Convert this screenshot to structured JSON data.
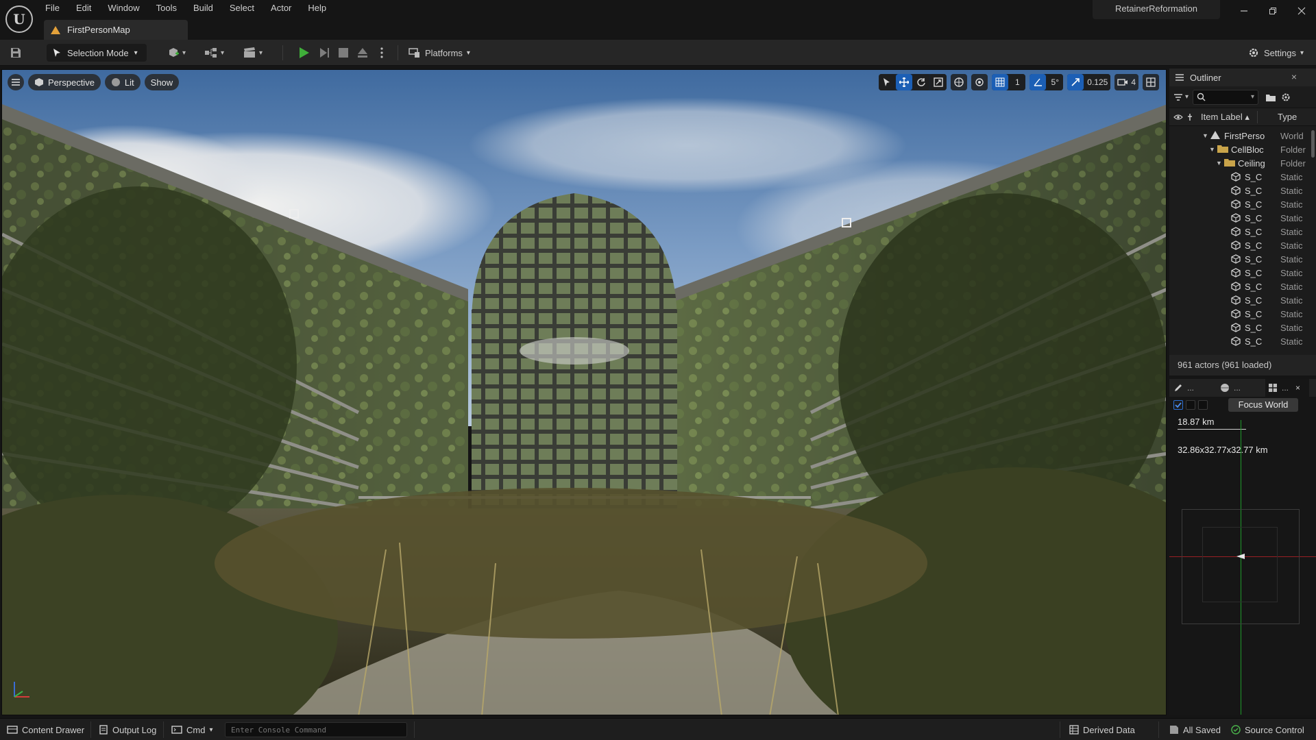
{
  "app": {
    "menu": [
      "File",
      "Edit",
      "Window",
      "Tools",
      "Build",
      "Select",
      "Actor",
      "Help"
    ],
    "project_name": "RetainerReformation",
    "map_tab": "FirstPersonMap",
    "window_buttons": [
      "minimize-icon",
      "restore-icon",
      "close-icon"
    ]
  },
  "toolbar": {
    "selection_mode": "Selection Mode",
    "platforms": "Platforms",
    "settings": "Settings"
  },
  "viewport": {
    "view_mode": "Perspective",
    "lighting": "Lit",
    "show": "Show",
    "grid_snap": "1",
    "angle_snap": "5°",
    "scale_snap": "0.125",
    "camera_speed": "4"
  },
  "outliner": {
    "title": "Outliner",
    "col_label": "Item Label ▴",
    "col_type": "Type",
    "rows": [
      {
        "label": "FirstPerso",
        "type": "World",
        "depth": 0,
        "icon": "world-icon"
      },
      {
        "label": "CellBloc",
        "type": "Folder",
        "depth": 1,
        "icon": "folder-icon"
      },
      {
        "label": "Ceiling",
        "type": "Folder",
        "depth": 2,
        "icon": "folder-icon"
      },
      {
        "label": "S_C",
        "type": "Static",
        "depth": 3,
        "icon": "static-mesh-icon"
      },
      {
        "label": "S_C",
        "type": "Static",
        "depth": 3,
        "icon": "static-mesh-icon"
      },
      {
        "label": "S_C",
        "type": "Static",
        "depth": 3,
        "icon": "static-mesh-icon"
      },
      {
        "label": "S_C",
        "type": "Static",
        "depth": 3,
        "icon": "static-mesh-icon"
      },
      {
        "label": "S_C",
        "type": "Static",
        "depth": 3,
        "icon": "static-mesh-icon"
      },
      {
        "label": "S_C",
        "type": "Static",
        "depth": 3,
        "icon": "static-mesh-icon"
      },
      {
        "label": "S_C",
        "type": "Static",
        "depth": 3,
        "icon": "static-mesh-icon"
      },
      {
        "label": "S_C",
        "type": "Static",
        "depth": 3,
        "icon": "static-mesh-icon"
      },
      {
        "label": "S_C",
        "type": "Static",
        "depth": 3,
        "icon": "static-mesh-icon"
      },
      {
        "label": "S_C",
        "type": "Static",
        "depth": 3,
        "icon": "static-mesh-icon"
      },
      {
        "label": "S_C",
        "type": "Static",
        "depth": 3,
        "icon": "static-mesh-icon"
      },
      {
        "label": "S_C",
        "type": "Static",
        "depth": 3,
        "icon": "static-mesh-icon"
      },
      {
        "label": "S_C",
        "type": "Static",
        "depth": 3,
        "icon": "static-mesh-icon"
      }
    ],
    "footer": "961 actors (961 loaded)"
  },
  "world_partition": {
    "tab1_label": "...",
    "tab2_label": "...",
    "tab3_label": "...",
    "focus_button": "Focus World",
    "scale_text": "18.87 km",
    "dimensions_text": "32.86x32.77x32.77 km"
  },
  "statusbar": {
    "content_drawer": "Content Drawer",
    "output_log": "Output Log",
    "cmd": "Cmd",
    "console_placeholder": "Enter Console Command",
    "derived_data": "Derived Data",
    "all_saved": "All Saved",
    "source_control": "Source Control"
  },
  "colors": {
    "accent_blue": "#1c5fb5",
    "play_green": "#3fae3a",
    "folder_yellow": "#c9a44a",
    "saved_green": "#49b04a"
  }
}
